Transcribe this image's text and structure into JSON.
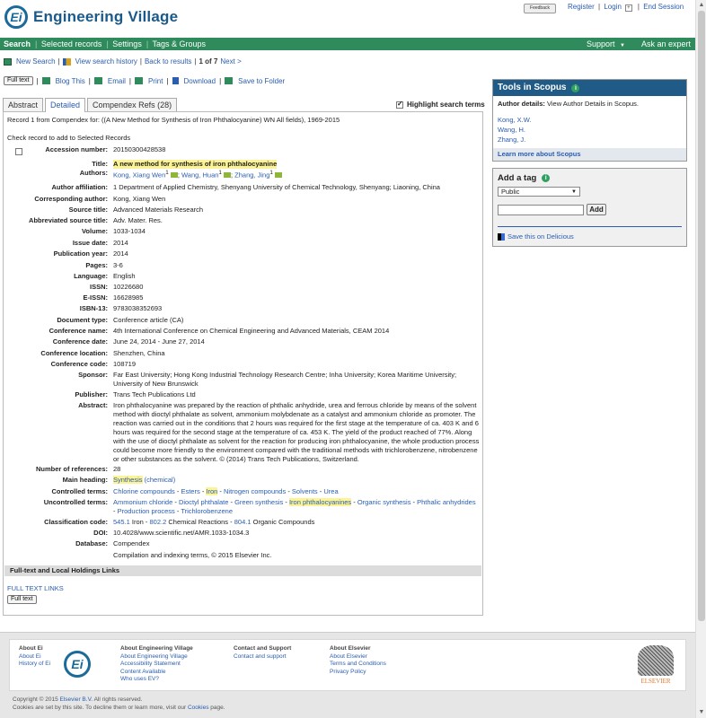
{
  "header": {
    "app_name": "Engineering Village",
    "logo_letters": "Ei",
    "feedback_label": "Feedback",
    "links": [
      "Register",
      "Login",
      "End Session"
    ]
  },
  "nav": {
    "items": [
      "Search",
      "Selected records",
      "Settings",
      "Tags & Groups"
    ],
    "support": "Support",
    "support_caret": "▼",
    "ask": "Ask an expert"
  },
  "toolbar1": {
    "new_search": "New Search",
    "history": "View search history",
    "back": "Back to results",
    "position": "1 of 7",
    "next": "Next >"
  },
  "toolbar2": {
    "full_text": "Full text",
    "blog": "Blog This",
    "email": "Email",
    "print": "Print",
    "download": "Download",
    "save": "Save to Folder"
  },
  "tabs": [
    "Abstract",
    "Detailed",
    "Compendex Refs (28)"
  ],
  "highlight_label": "Highlight search terms",
  "record": {
    "info": "Record 1 from Compendex for: ((A New Method for Synthesis of Iron Phthalocyanine) WN All fields), 1969-2015",
    "check_label": "Check record to add to Selected Records",
    "fields": {
      "accession_label": "Accession number:",
      "accession": "20150300428538",
      "title_label": "Title:",
      "title": "A new method for synthesis of iron phthalocyanine",
      "authors_label": "Authors:",
      "author1": "Kong, Xiang Wen",
      "author2": "Wang, Huan",
      "author3": "Zhang, Jing",
      "author_sup": "1",
      "affiliation_label": "Author affiliation:",
      "affiliation": "1 Department of Applied Chemistry, Shenyang University of Chemical Technology, Shenyang; Liaoning, China",
      "corr_label": "Corresponding author:",
      "corr": "Kong, Xiang Wen",
      "source_label": "Source title:",
      "source": "Advanced Materials Research",
      "abbr_label": "Abbreviated source title:",
      "abbr": "Adv. Mater. Res.",
      "volume_label": "Volume:",
      "volume": "1033-1034",
      "issue_label": "Issue date:",
      "issue": "2014",
      "pubyear_label": "Publication year:",
      "pubyear": "2014",
      "pages_label": "Pages:",
      "pages": "3-6",
      "lang_label": "Language:",
      "lang": "English",
      "issn_label": "ISSN:",
      "issn": "10226680",
      "eissn_label": "E-ISSN:",
      "eissn": "16628985",
      "isbn_label": "ISBN-13:",
      "isbn": "9783038352693",
      "doctype_label": "Document type:",
      "doctype": "Conference article (CA)",
      "confname_label": "Conference name:",
      "confname": "4th International Conference on Chemical Engineering and Advanced Materials, CEAM 2014",
      "confdate_label": "Conference date:",
      "confdate": "June 24, 2014 - June 27, 2014",
      "confloc_label": "Conference location:",
      "confloc": "Shenzhen, China",
      "confcode_label": "Conference code:",
      "confcode": "108719",
      "sponsor_label": "Sponsor:",
      "sponsor": "Far East University; Hong Kong Industrial Technology Research Centre; Inha University; Korea Maritime University; University of New Brunswick",
      "publisher_label": "Publisher:",
      "publisher": "Trans Tech Publications Ltd",
      "abstract_label": "Abstract:",
      "abstract": "Iron phthalocyanine was prepared by the reaction of phthalic anhydride, urea and ferrous chloride by means of the solvent method with dioctyl phthalate as solvent, ammonium molybdenate as a catalyst and ammonium chloride as promoter. The reaction was carried out in the conditions that 2 hours was required for the first stage at the temperature of ca. 403 K and 6 hours was required for the second stage at the temperature of ca. 453 K. The yield of the product reached of 77%. Along with the use of dioctyl phthalate as solvent for the reaction for producing iron phthalocyanine, the whole production process could become more friendly to the environment compared with the traditional methods with trichlorobenzene, nitrobenzene or other substances as the solvent. © (2014) Trans Tech Publications, Switzerland.",
      "numref_label": "Number of references:",
      "numref": "28",
      "mainhead_label": "Main heading:",
      "mainhead": "Synthesis",
      "mainhead_q": "(chemical)",
      "controlled_label": "Controlled terms:",
      "controlled": [
        "Chlorine compounds",
        "Esters",
        "Iron",
        "Nitrogen compounds",
        "Solvents",
        "Urea"
      ],
      "uncontrolled_label": "Uncontrolled terms:",
      "uncontrolled": [
        "Ammonium chloride",
        "Dioctyl phthalate",
        "Green synthesis",
        "Iron phthalocyanines",
        "Organic synthesis",
        "Phthalic anhydrides",
        "Production process",
        "Trichlorobenzene"
      ],
      "class_label": "Classification code:",
      "class1_code": "545.1",
      "class1_name": "Iron",
      "class2_code": "802.2",
      "class2_name": "Chemical Reactions",
      "class3_code": "804.1",
      "class3_name": "Organic Compounds",
      "doi_label": "DOI:",
      "doi": "10.4028/www.scientific.net/AMR.1033-1034.3",
      "database_label": "Database:",
      "database": "Compendex",
      "compilation": "Compilation and indexing terms, © 2015 Elsevier Inc."
    },
    "holdings_header": "Full-text and Local Holdings Links",
    "fulltext_links": "FULL TEXT LINKS",
    "fulltext_btn": "Full text"
  },
  "scopus": {
    "title": "Tools in Scopus",
    "author_details_label": "Author details:",
    "author_details": "View Author Details in Scopus.",
    "authors": [
      "Kong, X.W.",
      "Wang, H.",
      "Zhang, J."
    ],
    "learn_more": "Learn more about Scopus"
  },
  "tag": {
    "title": "Add a tag",
    "select": "Public",
    "add": "Add",
    "delicious": "Save this on Delicious"
  },
  "footer": {
    "col1_title": "About Ei",
    "col1": [
      "About Ei",
      "History of Ei"
    ],
    "col2_title": "About Engineering Village",
    "col2": [
      "About Engineering Village",
      "Accessibility Statement",
      "Content Available",
      "Who uses EV?"
    ],
    "col3_title": "Contact and Support",
    "col3": [
      "Contact and support"
    ],
    "col4_title": "About Elsevier",
    "col4": [
      "About Elsevier",
      "Terms and Conditions",
      "Privacy Policy"
    ],
    "elsevier": "ELSEVIER",
    "copyright_pre": "Copyright © 2015",
    "copyright_link": "Elsevier B.V.",
    "copyright_post": "All rights reserved.",
    "cookies_pre": "Cookies are set by this site. To decline them or learn more, visit our",
    "cookies_link": "Cookies",
    "cookies_post": "page."
  },
  "colors": {
    "nav": "#2f8a5c",
    "scopus_header": "#1f5b86",
    "link": "#2a5db0",
    "highlight": "#fbf395"
  }
}
